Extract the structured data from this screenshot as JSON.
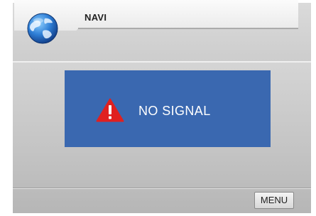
{
  "header": {
    "title": "NAVI",
    "app_icon": "globe-icon"
  },
  "alert": {
    "icon": "warning-icon",
    "message": "NO SIGNAL",
    "background_color": "#3a68b0",
    "icon_color": "#e02020"
  },
  "footer": {
    "menu_label": "MENU"
  }
}
